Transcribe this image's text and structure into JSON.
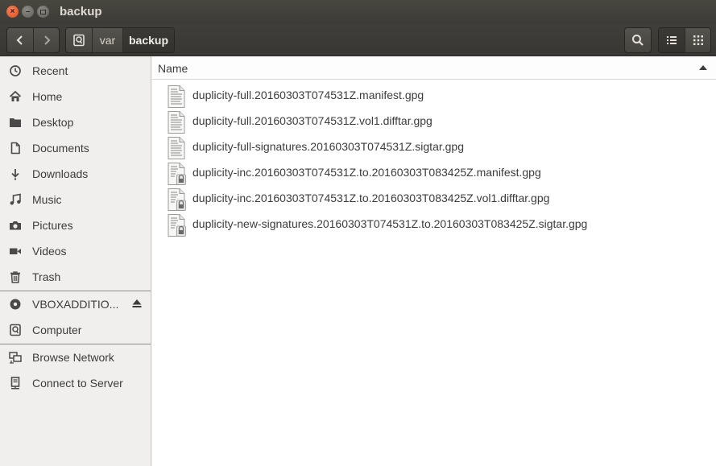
{
  "window": {
    "title": "backup",
    "controls": {
      "close": "×",
      "minimize": "–"
    }
  },
  "toolbar": {
    "back_icon": "chevron-left-icon",
    "forward_icon": "chevron-right-icon",
    "path": [
      "var",
      "backup"
    ],
    "search_icon": "search-icon",
    "list_view_icon": "list-view-icon",
    "grid_view_icon": "grid-view-icon"
  },
  "sidebar": {
    "places": [
      {
        "label": "Recent",
        "icon": "clock-icon"
      },
      {
        "label": "Home",
        "icon": "home-icon"
      },
      {
        "label": "Desktop",
        "icon": "folder-icon"
      },
      {
        "label": "Documents",
        "icon": "document-icon"
      },
      {
        "label": "Downloads",
        "icon": "download-icon"
      },
      {
        "label": "Music",
        "icon": "music-icon"
      },
      {
        "label": "Pictures",
        "icon": "camera-icon"
      },
      {
        "label": "Videos",
        "icon": "video-icon"
      },
      {
        "label": "Trash",
        "icon": "trash-icon"
      }
    ],
    "devices": [
      {
        "label": "VBOXADDITIO...",
        "icon": "disc-icon",
        "eject_icon": "eject-icon"
      },
      {
        "label": "Computer",
        "icon": "drive-icon"
      }
    ],
    "network": [
      {
        "label": "Browse Network",
        "icon": "network-icon"
      },
      {
        "label": "Connect to Server",
        "icon": "server-icon"
      }
    ]
  },
  "content": {
    "column_header": "Name",
    "sort": "ascending",
    "files": [
      {
        "name": "duplicity-full.20160303T074531Z.manifest.gpg",
        "icon": "text-file-icon"
      },
      {
        "name": "duplicity-full.20160303T074531Z.vol1.difftar.gpg",
        "icon": "text-file-icon"
      },
      {
        "name": "duplicity-full-signatures.20160303T074531Z.sigtar.gpg",
        "icon": "text-file-icon"
      },
      {
        "name": "duplicity-inc.20160303T074531Z.to.20160303T083425Z.manifest.gpg",
        "icon": "locked-file-icon"
      },
      {
        "name": "duplicity-inc.20160303T074531Z.to.20160303T083425Z.vol1.difftar.gpg",
        "icon": "locked-file-icon"
      },
      {
        "name": "duplicity-new-signatures.20160303T074531Z.to.20160303T083425Z.sigtar.gpg",
        "icon": "locked-file-icon"
      }
    ]
  }
}
